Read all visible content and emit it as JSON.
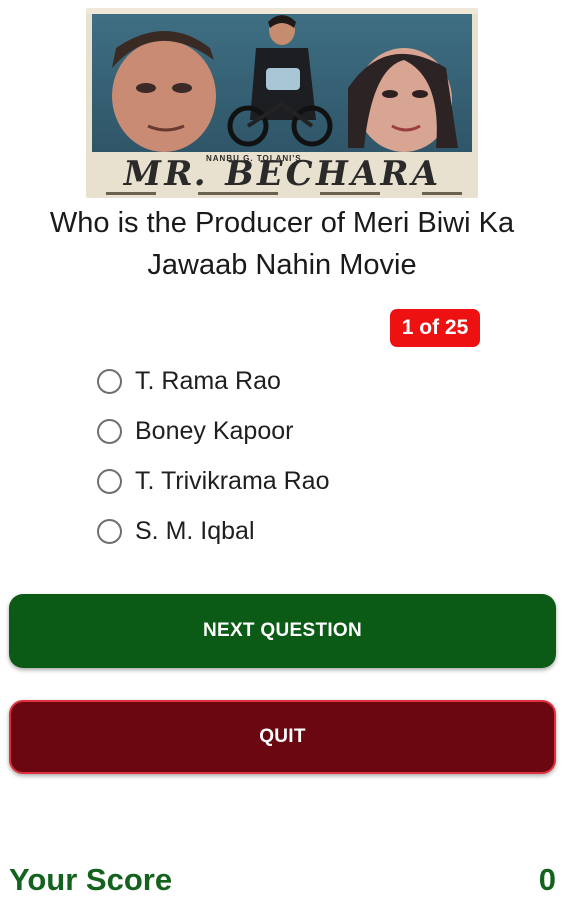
{
  "poster": {
    "tagline": "NANBU G. TOLANI'S",
    "title": "MR. BECHARA"
  },
  "question": {
    "text": "Who is the Producer of Meri Biwi Ka Jawaab Nahin Movie",
    "counter": "1 of 25"
  },
  "options": [
    {
      "label": "T. Rama Rao"
    },
    {
      "label": "Boney Kapoor"
    },
    {
      "label": "T. Trivikrama Rao"
    },
    {
      "label": "S. M. Iqbal"
    }
  ],
  "buttons": {
    "next_label": "NEXT QUESTION",
    "quit_label": "QUIT"
  },
  "score": {
    "label": "Your Score",
    "value": "0"
  },
  "colors": {
    "next_button": "#0b5a16",
    "quit_button": "#6a0711",
    "counter_badge": "#ee1111",
    "score_text": "#13631f"
  }
}
